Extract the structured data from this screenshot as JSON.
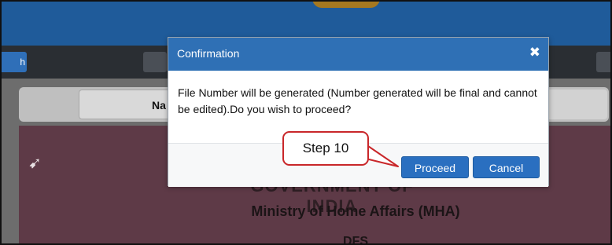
{
  "modal": {
    "title": "Confirmation",
    "message": "File Number will be generated (Number generated will be final and cannot be edited).Do you wish to proceed?",
    "buttons": {
      "proceed": "Proceed",
      "cancel": "Cancel"
    },
    "close_icon": "close-icon"
  },
  "annotation": {
    "step_label": "Step  10"
  },
  "background": {
    "nav_left_fragment": "h",
    "tab_fragment": "Na",
    "heading": "GOVERNMENT OF INDIA",
    "ministry": "Ministry of Home Affairs (MHA)",
    "dept": "DFS"
  },
  "colors": {
    "header_blue": "#2f70b5",
    "button_blue": "#2a6fc0",
    "callout_red": "#c9272a"
  }
}
